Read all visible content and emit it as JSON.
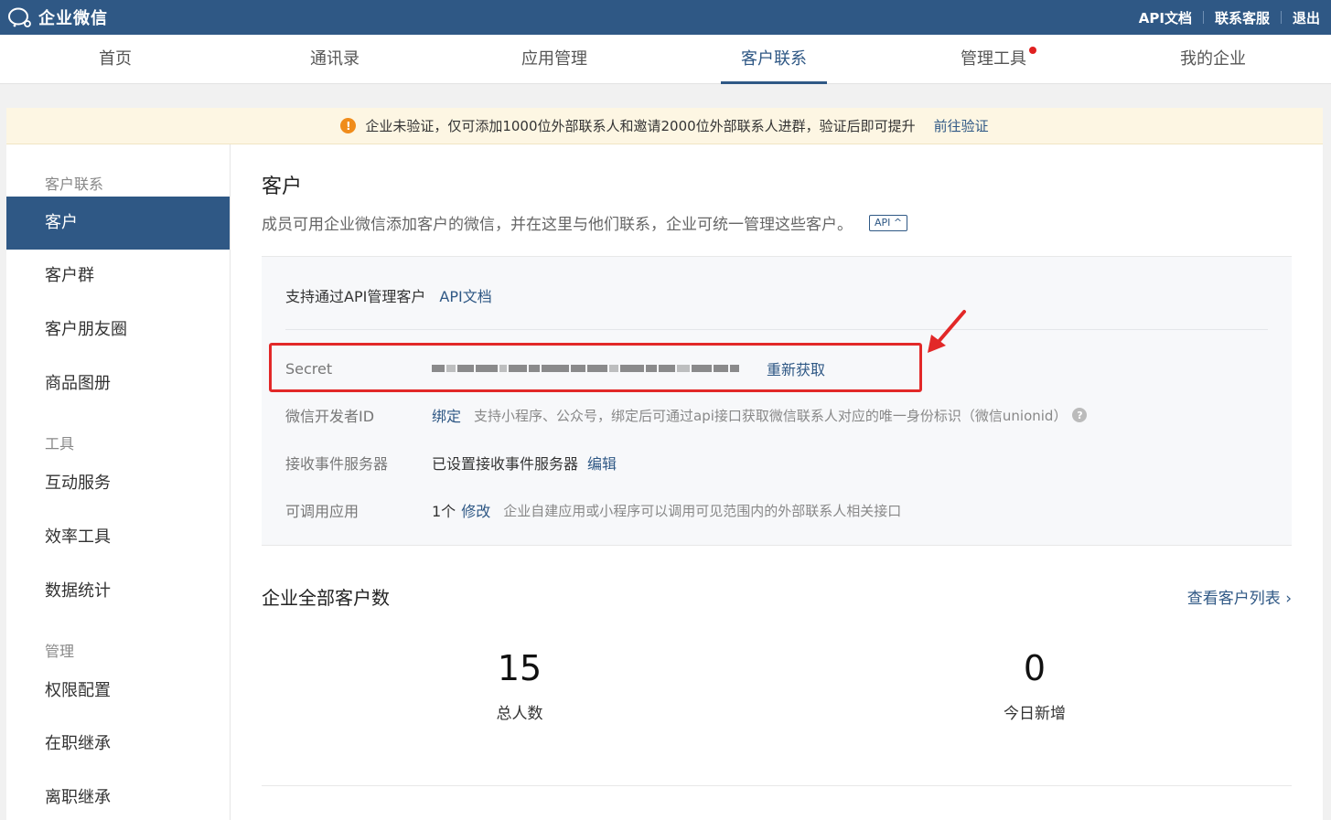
{
  "header": {
    "logo_text": "企业微信",
    "links": [
      {
        "label": "API文档"
      },
      {
        "label": "联系客服"
      },
      {
        "label": "退出"
      }
    ]
  },
  "nav": {
    "items": [
      {
        "label": "首页"
      },
      {
        "label": "通讯录"
      },
      {
        "label": "应用管理"
      },
      {
        "label": "客户联系",
        "active": true
      },
      {
        "label": "管理工具",
        "has_dot": true
      },
      {
        "label": "我的企业"
      }
    ]
  },
  "notice": {
    "text": "企业未验证，仅可添加1000位外部联系人和邀请2000位外部联系人进群，验证后即可提升",
    "link": "前往验证",
    "icon": "!"
  },
  "sidebar": {
    "groups": [
      {
        "title": "客户联系",
        "items": [
          "客户",
          "客户群",
          "客户朋友圈",
          "商品图册"
        ]
      },
      {
        "title": "工具",
        "items": [
          "互动服务",
          "效率工具",
          "数据统计"
        ]
      },
      {
        "title": "管理",
        "items": [
          "权限配置",
          "在职继承",
          "离职继承"
        ]
      }
    ],
    "active_item": "客户"
  },
  "main": {
    "title": "客户",
    "description": "成员可用企业微信添加客户的微信，并在这里与他们联系，企业可统一管理这些客户。",
    "api_badge": "API ^",
    "api_panel": {
      "intro": "支持通过API管理客户",
      "intro_link": "API文档",
      "rows": {
        "secret": {
          "label": "Secret",
          "action": "重新获取"
        },
        "dev_id": {
          "label": "微信开发者ID",
          "action": "绑定",
          "hint": "支持小程序、公众号，绑定后可通过api接口获取微信联系人对应的唯一身份标识（微信unionid）",
          "help": "?"
        },
        "event_server": {
          "label": "接收事件服务器",
          "value": "已设置接收事件服务器",
          "action": "编辑"
        },
        "apps": {
          "label": "可调用应用",
          "value": "1个",
          "action": "修改",
          "hint": "企业自建应用或小程序可以调用可见范围内的外部联系人相关接口"
        }
      }
    },
    "stats": {
      "title": "企业全部客户数",
      "link": "查看客户列表 ›",
      "items": [
        {
          "value": "15",
          "label": "总人数"
        },
        {
          "value": "0",
          "label": "今日新增"
        }
      ]
    }
  },
  "colors": {
    "brand": "#2f5885",
    "highlight": "#e22828",
    "warning": "#f08c1b"
  }
}
